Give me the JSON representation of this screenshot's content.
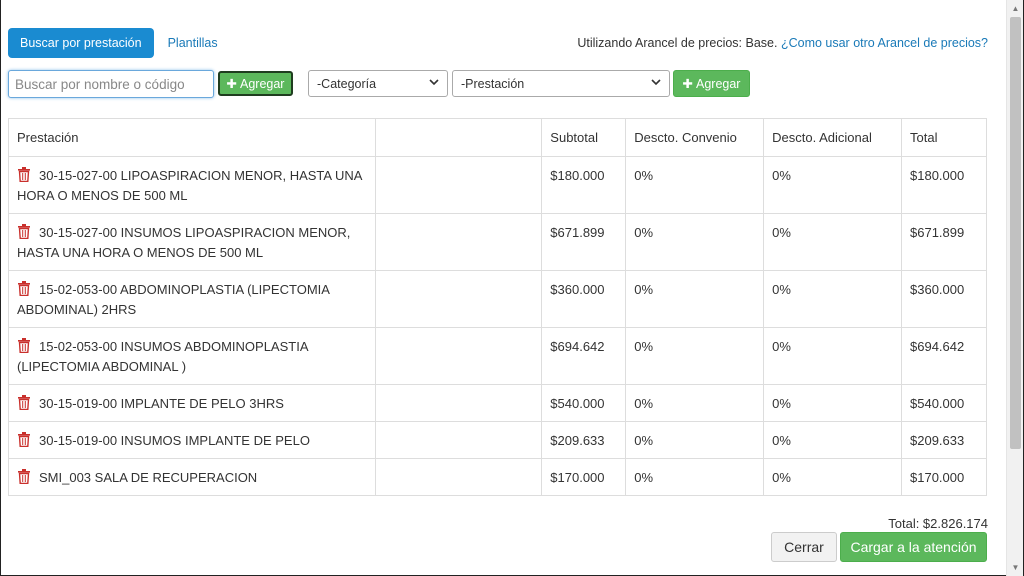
{
  "tabs": {
    "active": "Buscar por prestación",
    "other": "Plantillas"
  },
  "arancel": {
    "text": "Utilizando Arancel de precios: Base.",
    "link": "¿Como usar otro Arancel de precios?"
  },
  "search": {
    "placeholder": "Buscar por nombre o código",
    "value": "",
    "add_label": "Agregar"
  },
  "filters": {
    "category": "-Categoría",
    "service": "-Prestación",
    "add_label": "Agregar"
  },
  "table": {
    "headers": [
      "Prestación",
      "",
      "Subtotal",
      "Descto. Convenio",
      "Descto. Adicional",
      "Total"
    ],
    "rows": [
      {
        "name": "30-15-027-00 LIPOASPIRACION MENOR, HASTA UNA HORA O MENOS DE 500 ML",
        "subtotal": "$180.000",
        "convenio": "0%",
        "adicional": "0%",
        "total": "$180.000"
      },
      {
        "name": "30-15-027-00 INSUMOS LIPOASPIRACION MENOR, HASTA UNA HORA O MENOS DE 500 ML",
        "subtotal": "$671.899",
        "convenio": "0%",
        "adicional": "0%",
        "total": "$671.899"
      },
      {
        "name": "15-02-053-00 ABDOMINOPLASTIA (LIPECTOMIA ABDOMINAL) 2HRS",
        "subtotal": "$360.000",
        "convenio": "0%",
        "adicional": "0%",
        "total": "$360.000"
      },
      {
        "name": "15-02-053-00 INSUMOS ABDOMINOPLASTIA (LIPECTOMIA ABDOMINAL )",
        "subtotal": "$694.642",
        "convenio": "0%",
        "adicional": "0%",
        "total": "$694.642"
      },
      {
        "name": "30-15-019-00 IMPLANTE DE PELO 3HRS",
        "subtotal": "$540.000",
        "convenio": "0%",
        "adicional": "0%",
        "total": "$540.000"
      },
      {
        "name": "30-15-019-00 INSUMOS IMPLANTE DE PELO",
        "subtotal": "$209.633",
        "convenio": "0%",
        "adicional": "0%",
        "total": "$209.633"
      },
      {
        "name": "SMI_003 SALA DE RECUPERACION",
        "subtotal": "$170.000",
        "convenio": "0%",
        "adicional": "0%",
        "total": "$170.000"
      }
    ]
  },
  "footer": {
    "total": "Total: $2.826.174",
    "close_label": "Cerrar",
    "submit_label": "Cargar a la atención"
  },
  "colors": {
    "primary": "#1a8bd1",
    "success": "#5cb85c",
    "danger_icon": "#c9302c",
    "link": "#1a7ab8"
  },
  "icons": {
    "row_delete": "trash-icon",
    "add": "plus-icon",
    "select": "chevron-down-icon"
  }
}
